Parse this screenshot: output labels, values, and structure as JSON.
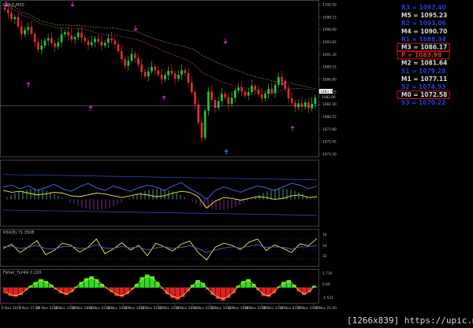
{
  "chart": {
    "symbol_label": "GOLD,M30",
    "current_price": "1083.76",
    "last_price": "1082.06"
  },
  "pivots": [
    {
      "label": "R3 = 1097.40",
      "color": "#1f3fd6"
    },
    {
      "label": "M5 = 1095.23",
      "color": "#d9d9d9"
    },
    {
      "label": "R2 = 1093.06",
      "color": "#1f3fd6"
    },
    {
      "label": "M4 = 1090.70",
      "color": "#d9d9d9"
    },
    {
      "label": "R1 = 1088.34",
      "color": "#1f3fd6"
    },
    {
      "label": "M3 = 1086.17",
      "color": "#d9d9d9",
      "boxed": true
    },
    {
      "label": "P  = 1083.99",
      "color": "#e03020",
      "boxed": true
    },
    {
      "label": "M2 = 1081.64",
      "color": "#d9d9d9"
    },
    {
      "label": "S1 = 1079.28",
      "color": "#1f3fd6"
    },
    {
      "label": "M1 = 1077.11",
      "color": "#d9d9d9"
    },
    {
      "label": "S2 = 1074.93",
      "color": "#1f3fd6"
    },
    {
      "label": "M0 = 1072.58",
      "color": "#d9d9d9",
      "boxed": true
    },
    {
      "label": "S3 = 1070.22",
      "color": "#1f3fd6"
    }
  ],
  "price_axis": [
    "1100.50",
    "1098.15",
    "1096.00",
    "1093.65",
    "1091.30",
    "1089.15",
    "1086.80",
    "1084.65",
    "1082.30",
    "1080.15",
    "1077.80",
    "1075.45",
    "1073.30"
  ],
  "osc1_axis": [],
  "osc2": {
    "label": "RSX(8) 71.3508",
    "axis": [
      "70",
      "50",
      "32"
    ]
  },
  "osc3": {
    "label": "Fisher_Yur4ik 0.220",
    "axis": [
      "1.716",
      "0.00",
      "-1.531"
    ]
  },
  "time_axis": [
    "6 Nov 2015",
    "9 Nov 17:00",
    "10 Nov 02:00",
    "10 Nov 10:00",
    "10 Nov 18:00",
    "11 Nov 02:00",
    "11 Nov 10:00",
    "11 Nov 18:00",
    "12 Nov 02:00",
    "12 Nov 10:00",
    "12 Nov 18:00",
    "13 Nov 02:00",
    "13 Nov 10:00",
    "13 Nov 18:00",
    "16 Nov 02:00",
    "16 Nov 10:00",
    "17 Nov 02:00",
    "17 Nov 10:00",
    "17 Nov 21:00"
  ],
  "watermark": "[1266x839] https://upic.me/",
  "chart_data": [
    {
      "type": "candlestick",
      "title": "GOLD,M30",
      "ylim": [
        1073.3,
        1100.5
      ],
      "close": [
        1099.2,
        1098.6,
        1097.5,
        1097.9,
        1096.2,
        1094.8,
        1095.6,
        1096.1,
        1094.9,
        1093.4,
        1092.1,
        1092.8,
        1093.7,
        1094.1,
        1093.2,
        1092.6,
        1093.4,
        1094.8,
        1095.2,
        1094.6,
        1093.9,
        1094.3,
        1095.1,
        1094.2,
        1093.6,
        1092.9,
        1093.4,
        1094.0,
        1093.5,
        1092.8,
        1093.3,
        1094.1,
        1093.7,
        1093.0,
        1091.8,
        1090.4,
        1089.2,
        1090.1,
        1091.3,
        1090.6,
        1089.4,
        1088.1,
        1087.3,
        1088.2,
        1089.0,
        1088.4,
        1087.6,
        1086.8,
        1087.5,
        1088.3,
        1087.8,
        1086.9,
        1087.6,
        1088.4,
        1087.9,
        1086.2,
        1084.5,
        1082.3,
        1079.1,
        1076.4,
        1081.2,
        1084.6,
        1083.1,
        1081.7,
        1082.9,
        1084.2,
        1083.6,
        1082.4,
        1083.5,
        1084.8,
        1085.3,
        1084.6,
        1083.9,
        1084.5,
        1085.6,
        1084.9,
        1084.1,
        1083.4,
        1084.2,
        1085.1,
        1084.4,
        1085.8,
        1087.2,
        1086.5,
        1085.1,
        1083.4,
        1082.6,
        1081.8,
        1082.5,
        1081.9,
        1082.7,
        1081.6,
        1082.4,
        1083.5
      ]
    },
    {
      "type": "line",
      "series": [
        {
          "values": [
            62,
            64,
            60,
            63,
            58,
            61,
            65,
            60,
            57,
            62,
            66,
            61,
            58,
            63,
            60,
            57,
            61,
            64,
            62,
            58,
            63,
            67,
            60,
            55,
            48,
            58,
            62,
            59,
            56,
            60,
            63,
            61,
            58,
            62,
            66,
            64,
            60,
            63
          ]
        },
        {
          "values": [
            58,
            56,
            57,
            55,
            53,
            54,
            56,
            55,
            52,
            51,
            53,
            55,
            54,
            52,
            50,
            52,
            54,
            53,
            51,
            52,
            55,
            57,
            56,
            51,
            38,
            46,
            50,
            49,
            47,
            49,
            51,
            50,
            48,
            49,
            52,
            53,
            50,
            51
          ]
        }
      ],
      "ylim": [
        20,
        90
      ]
    },
    {
      "type": "line",
      "title": "RSX(8) 71.3508",
      "series": [
        {
          "values": [
            52,
            60,
            44,
            55,
            67,
            40,
            48,
            62,
            58,
            45,
            54,
            70,
            42,
            51,
            63,
            49,
            58,
            38,
            62,
            55,
            47,
            60,
            66,
            44,
            30,
            54,
            62,
            58,
            50,
            64,
            70,
            48,
            59,
            52,
            44,
            61,
            57,
            71
          ]
        },
        {
          "values": [
            55,
            56,
            52,
            54,
            58,
            52,
            51,
            55,
            56,
            52,
            53,
            59,
            53,
            52,
            56,
            53,
            55,
            49,
            53,
            55,
            52,
            54,
            57,
            52,
            44,
            49,
            53,
            55,
            53,
            56,
            59,
            54,
            55,
            54,
            51,
            55,
            55,
            58
          ]
        }
      ],
      "ylim": [
        20,
        85
      ]
    },
    {
      "type": "bar",
      "title": "Fisher_Yur4ik 0.220",
      "values": [
        -0.6,
        -0.9,
        -1.0,
        -0.8,
        -0.3,
        0.2,
        0.6,
        0.9,
        0.7,
        0.3,
        -0.2,
        -0.6,
        -0.8,
        -0.5,
        0.1,
        0.6,
        1.0,
        1.2,
        0.9,
        0.4,
        -0.1,
        -0.5,
        -0.9,
        -1.0,
        -0.7,
        -0.2,
        0.4,
        1.1,
        1.4,
        1.2,
        0.6,
        -0.1,
        -0.7,
        -1.1,
        -1.3,
        -1.0,
        -0.4,
        0.3,
        0.8,
        0.5,
        -0.2,
        -0.8,
        -1.2,
        -1.4,
        -1.1,
        -0.6,
        0.2,
        0.7,
        0.9,
        0.4,
        -0.3,
        -0.9,
        -1.0,
        -0.6,
        0.1,
        0.6,
        0.8,
        0.3,
        -0.4,
        -0.8,
        -0.5,
        0.2
      ],
      "ylim": [
        -1.531,
        1.716
      ]
    }
  ]
}
